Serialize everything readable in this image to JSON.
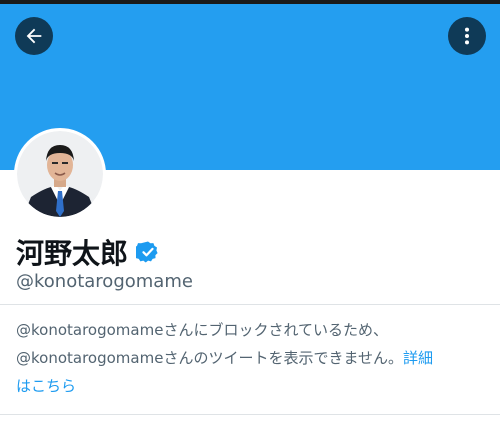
{
  "header": {
    "back_icon": "arrow-left-icon",
    "more_icon": "more-vertical-icon",
    "banner_color": "#249ef0",
    "button_color": "#0f3a57"
  },
  "profile": {
    "display_name": "河野太郎",
    "verified_icon": "verified-badge-icon",
    "verified_color": "#1d9bf0",
    "handle": "@konotarogomame"
  },
  "notice": {
    "line1": "@konotarogomameさんにブロックされているため、",
    "line2": "@konotarogomameさんのツイートを表示できません。",
    "link_part1": "詳細",
    "link_part2": "はこちら",
    "link_color": "#1d9bf0"
  }
}
